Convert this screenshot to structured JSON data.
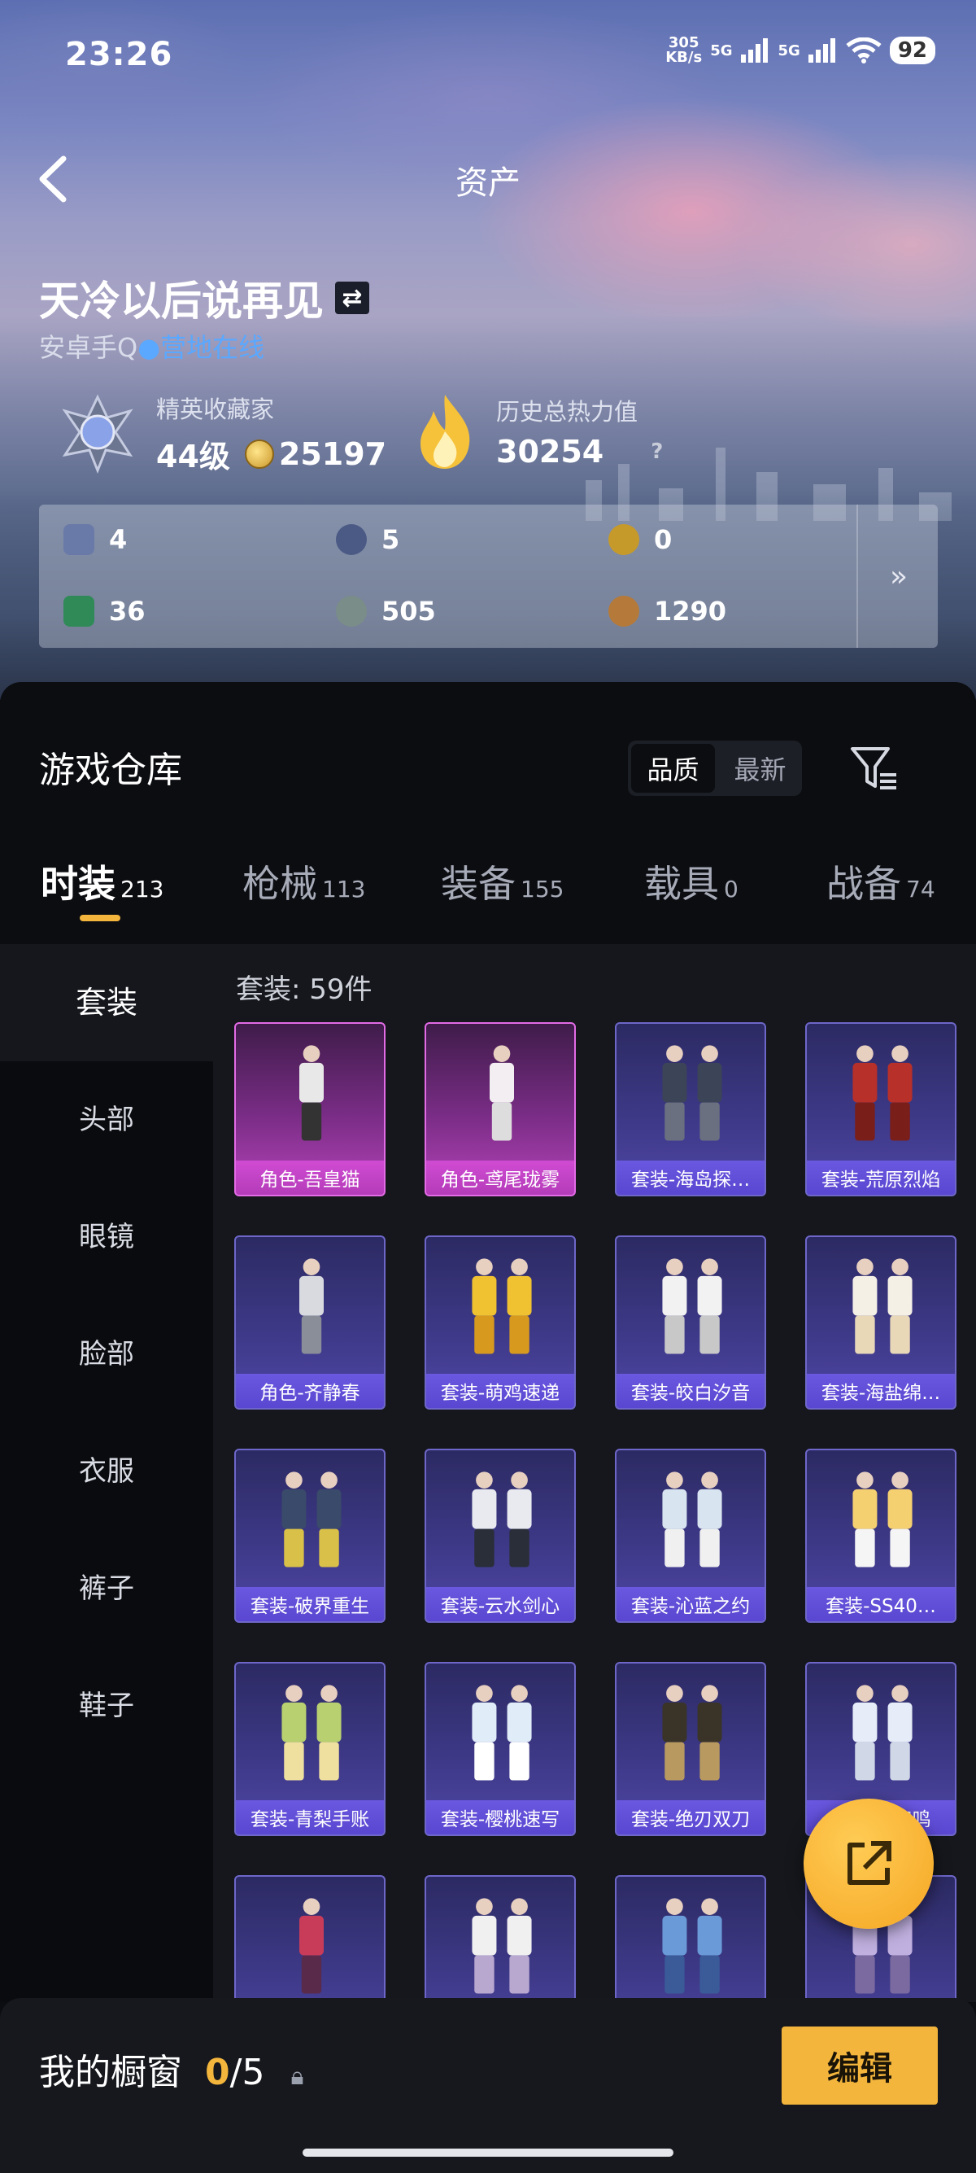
{
  "status_bar": {
    "time": "23:26",
    "net_speed_value": "305",
    "net_speed_unit": "KB/s",
    "sim1": "5G",
    "sim2": "5G",
    "battery": "92"
  },
  "header": {
    "title": "资产"
  },
  "profile": {
    "name": "天冷以后说再见",
    "platform": "安卓手Q",
    "online_status": "营地在线",
    "collector_title": "精英收藏家",
    "level": "44级",
    "coins": "25197",
    "heat_label": "历史总热力值",
    "heat_value": "30254",
    "heat_help": "?"
  },
  "resources": [
    {
      "icon": "card-icon",
      "value": "4"
    },
    {
      "icon": "blue-badge-icon",
      "value": "5"
    },
    {
      "icon": "gold-badge-icon",
      "value": "0"
    },
    {
      "icon": "green-card-icon",
      "value": "36"
    },
    {
      "icon": "silver-coin-icon",
      "value": "505"
    },
    {
      "icon": "bronze-coin-icon",
      "value": "1290"
    }
  ],
  "resources_more": "»",
  "warehouse": {
    "title": "游戏仓库",
    "sort": [
      "品质",
      "最新"
    ],
    "tabs": [
      {
        "label": "时装",
        "count": "213"
      },
      {
        "label": "枪械",
        "count": "113"
      },
      {
        "label": "装备",
        "count": "155"
      },
      {
        "label": "载具",
        "count": "0"
      },
      {
        "label": "战备",
        "count": "74"
      }
    ],
    "sidebar": [
      "套装",
      "头部",
      "眼镜",
      "脸部",
      "衣服",
      "裤子",
      "鞋子"
    ],
    "count_label": "套装: 59件",
    "items": [
      {
        "name": "角色-吾皇猫",
        "rarity": "pink"
      },
      {
        "name": "角色-鸢尾珑雾",
        "rarity": "pink"
      },
      {
        "name": "套装-海岛探…",
        "rarity": "purple"
      },
      {
        "name": "套装-荒原烈焰",
        "rarity": "purple"
      },
      {
        "name": "角色-齐静春",
        "rarity": "purple"
      },
      {
        "name": "套装-萌鸡速递",
        "rarity": "purple"
      },
      {
        "name": "套装-皎白汐音",
        "rarity": "purple"
      },
      {
        "name": "套装-海盐绵…",
        "rarity": "purple"
      },
      {
        "name": "套装-破界重生",
        "rarity": "purple"
      },
      {
        "name": "套装-云水剑心",
        "rarity": "purple"
      },
      {
        "name": "套装-沁蓝之约",
        "rarity": "purple"
      },
      {
        "name": "套装-SS40…",
        "rarity": "purple"
      },
      {
        "name": "套装-青梨手账",
        "rarity": "purple"
      },
      {
        "name": "套装-樱桃速写",
        "rarity": "purple"
      },
      {
        "name": "套装-绝刃双刀",
        "rarity": "purple"
      },
      {
        "name": "套装-…和鸣",
        "rarity": "purple"
      },
      {
        "name": "",
        "rarity": "purple"
      },
      {
        "name": "",
        "rarity": "purple"
      },
      {
        "name": "",
        "rarity": "purple"
      },
      {
        "name": "",
        "rarity": "purple"
      }
    ]
  },
  "showcase": {
    "label": "我的橱窗",
    "current": "0",
    "total": "/5",
    "edit": "编辑"
  },
  "colors": {
    "accent": "#f3b53c",
    "online": "#5aa8ff",
    "pink_card": "#b543b9",
    "purple_card": "#5047a6"
  }
}
